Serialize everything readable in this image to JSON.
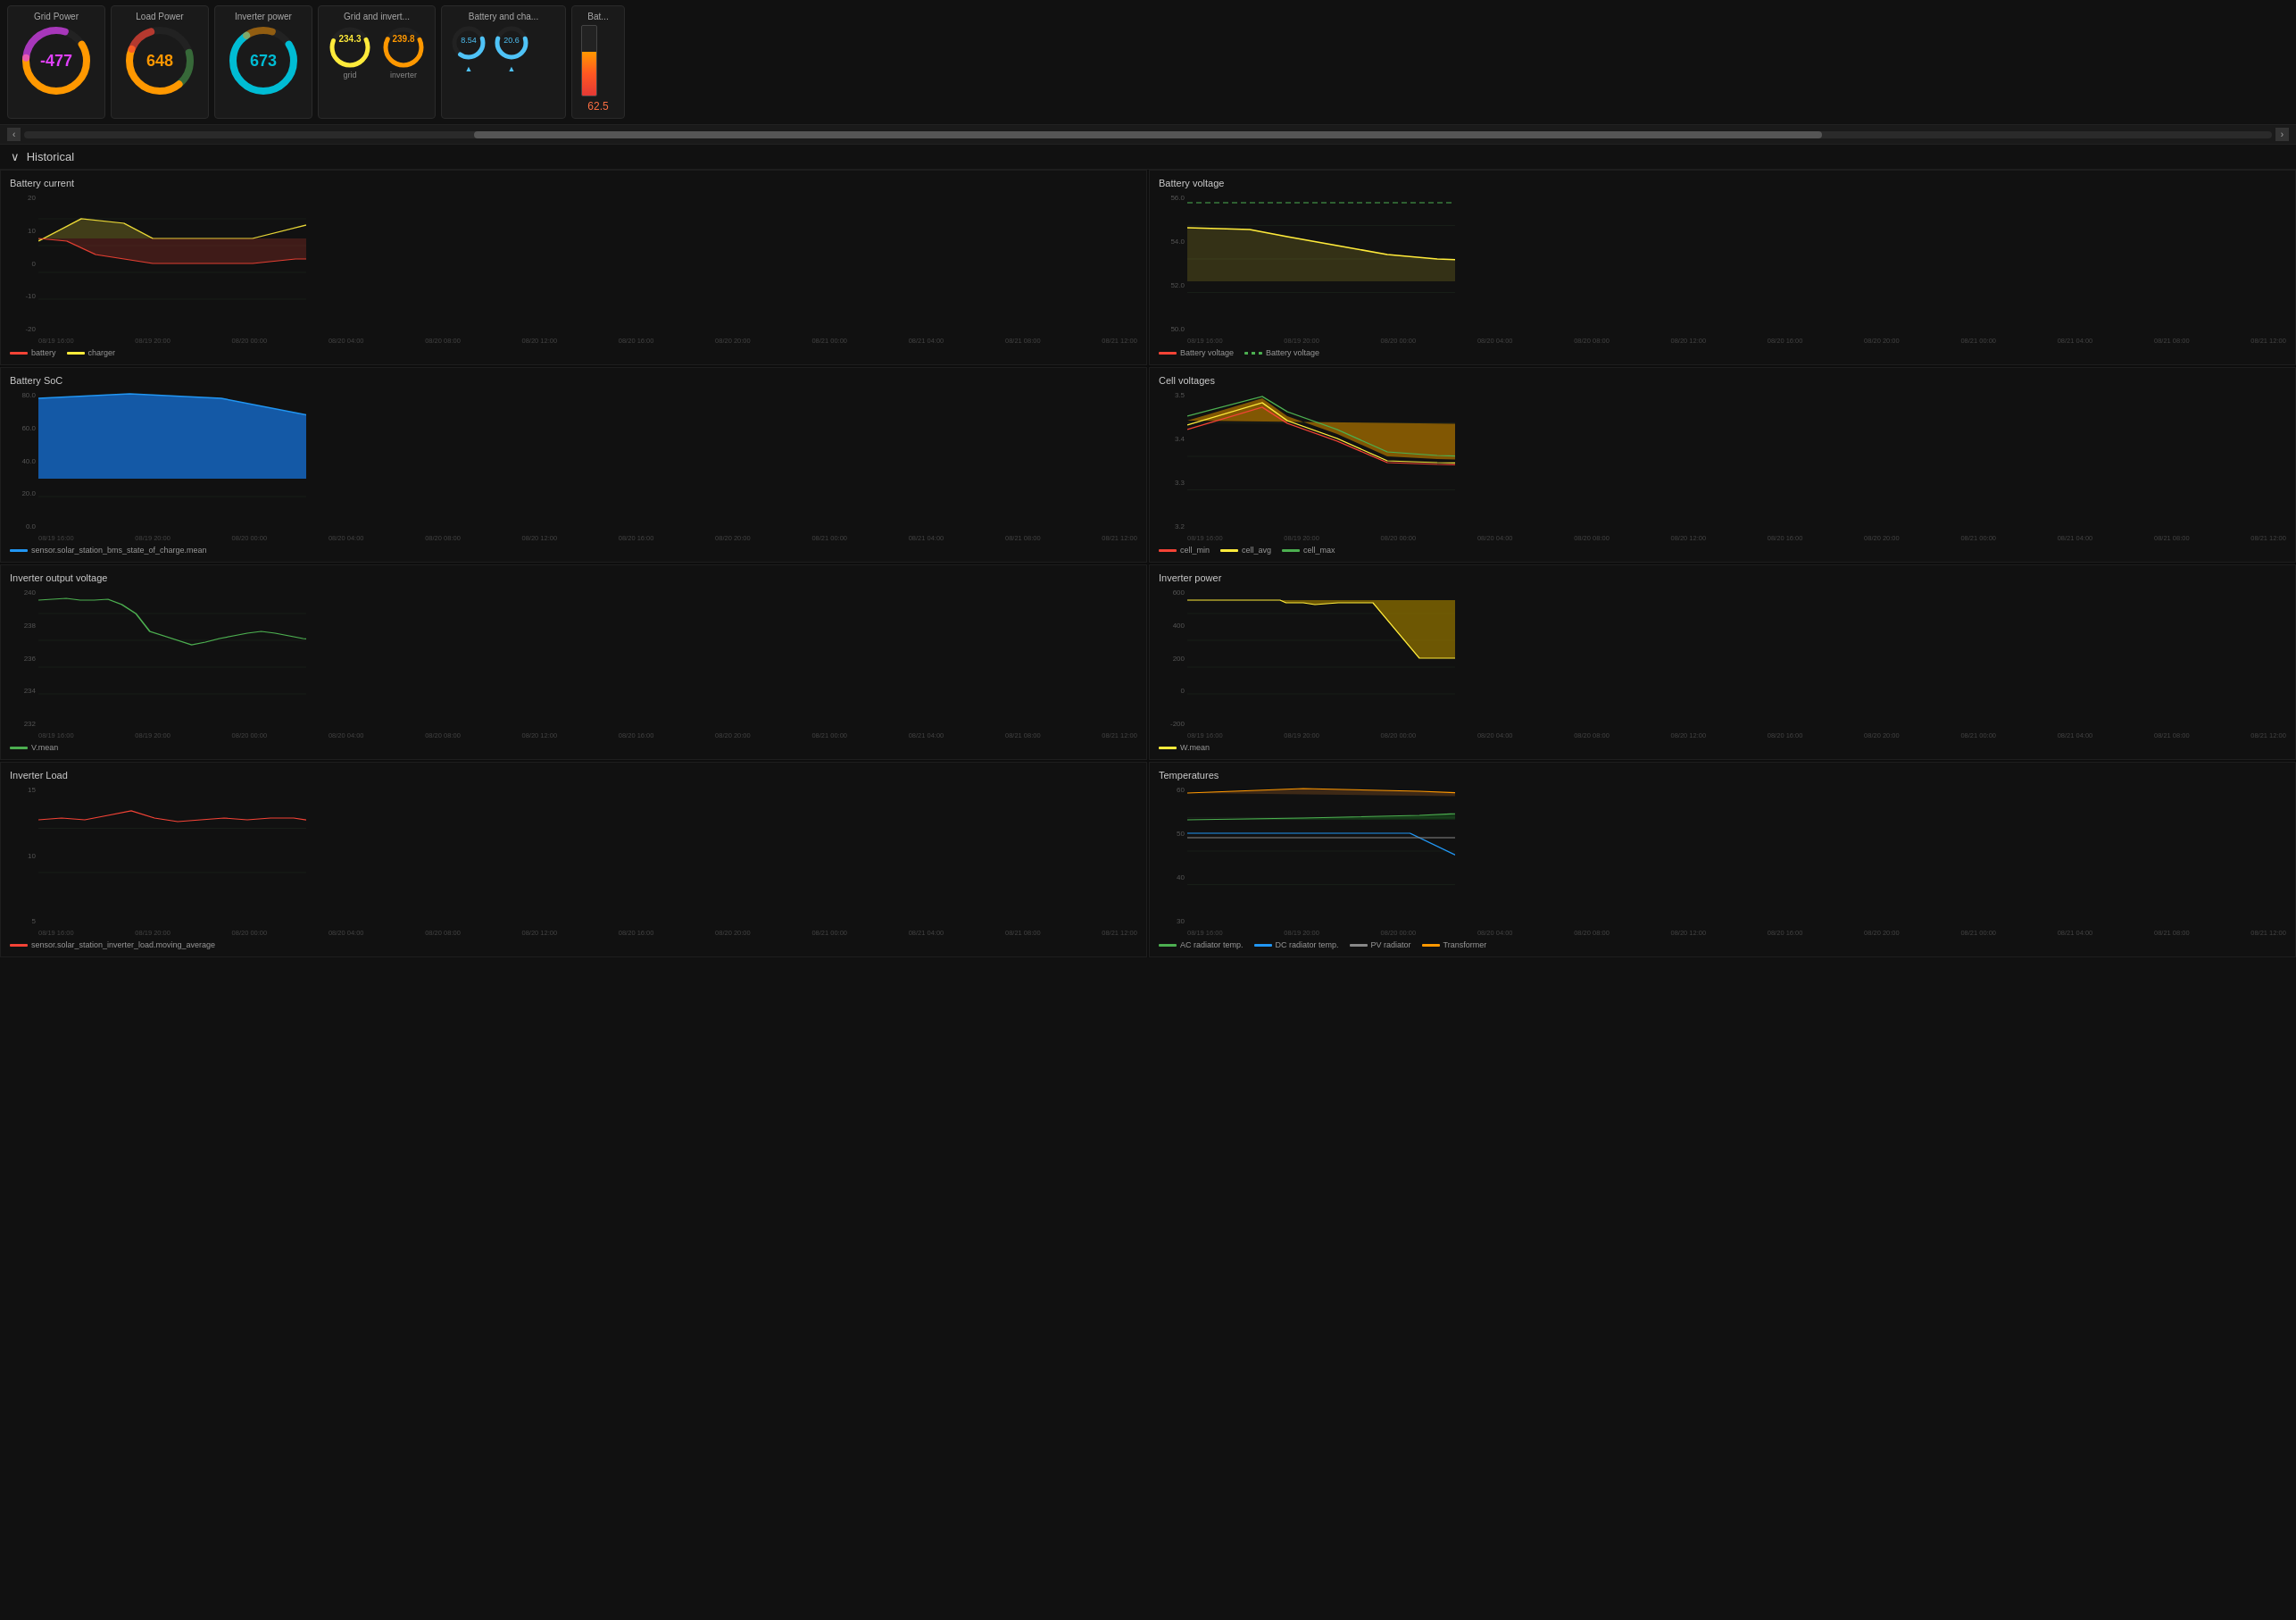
{
  "topBar": {
    "cards": [
      {
        "id": "grid-power",
        "title": "Grid Power",
        "value": "-477",
        "valueClass": "negative",
        "gaugeColor": "#e040fb",
        "arcColor": "#ff9800",
        "bgColor": "#1a1a1a"
      },
      {
        "id": "load-power",
        "title": "Load Power",
        "value": "648",
        "valueClass": "orange",
        "gaugeColor": "#ff9800",
        "arcColor": "#ff9800",
        "bgColor": "#1a1a1a"
      },
      {
        "id": "inverter-power",
        "title": "Inverter power",
        "value": "673",
        "valueClass": "cyan",
        "gaugeColor": "#00bcd4",
        "arcColor": "#00bcd4",
        "bgColor": "#1a1a1a"
      }
    ],
    "gridInverter": {
      "title": "Grid and invert...",
      "gridLabel": "grid",
      "inverterLabel": "inverter",
      "gridVal": "234.3",
      "inverterVal": "239.8"
    },
    "batteryCharge": {
      "title": "Battery and cha...",
      "val1": "8.54",
      "val2": "20.6",
      "arrow1": "▲",
      "arrow2": "▲"
    },
    "bat": {
      "title": "Bat...",
      "value": "62.5",
      "fillPercent": 62.5
    }
  },
  "historical": {
    "label": "Historical",
    "chevron": "∨"
  },
  "xLabels": [
    "08/19 16:00",
    "08/19 20:00",
    "08/20 00:00",
    "08/20 04:00",
    "08/20 08:00",
    "08/20 12:00",
    "08/20 16:00",
    "08/20 20:00",
    "08/21 00:00",
    "08/21 04:00",
    "08/21 08:00",
    "08/21 12:00"
  ],
  "charts": {
    "batteryCurrentTitle": "Battery current",
    "batteryCurrentYLabels": [
      "20",
      "10",
      "0",
      "-10",
      "-20"
    ],
    "batteryCurrentLegend": [
      {
        "label": "battery",
        "color": "#f44336"
      },
      {
        "label": "charger",
        "color": "#ffeb3b"
      }
    ],
    "batteryVoltageTitle": "Battery voltage",
    "batteryVoltageYLabels": [
      "56.0",
      "54.0",
      "52.0",
      "50.0"
    ],
    "batteryVoltageLegend": [
      {
        "label": "Battery voltage",
        "color": "#f44336",
        "dash": false
      },
      {
        "label": "Battery voltage",
        "color": "#4caf50",
        "dash": true
      }
    ],
    "batterySoCTitle": "Battery SoC",
    "batterySoCYLabels": [
      "80.0",
      "60.0",
      "40.0",
      "20.0",
      "0.0"
    ],
    "batterySoCLegend": [
      {
        "label": "sensor.solar_station_bms_state_of_charge.mean",
        "color": "#2196f3"
      }
    ],
    "cellVoltagesTitle": "Cell voltages",
    "cellVoltagesYLabels": [
      "3.5",
      "3.4",
      "3.3",
      "3.2"
    ],
    "cellVoltagesLegend": [
      {
        "label": "cell_min",
        "color": "#f44336"
      },
      {
        "label": "cell_avg",
        "color": "#ffeb3b"
      },
      {
        "label": "cell_max",
        "color": "#4caf50"
      }
    ],
    "inverterOutputTitle": "Inverter output voltage",
    "inverterOutputYLabels": [
      "240",
      "238",
      "236",
      "234",
      "232"
    ],
    "inverterOutputLegend": [
      {
        "label": "V.mean",
        "color": "#4caf50"
      }
    ],
    "inverterPowerTitle": "Inverter power",
    "inverterPowerYLabels": [
      "600",
      "400",
      "200",
      "0",
      "-200"
    ],
    "inverterPowerLegend": [
      {
        "label": "W.mean",
        "color": "#ffeb3b"
      }
    ],
    "inverterLoadTitle": "Inverter Load",
    "inverterLoadYLabels": [
      "15",
      "10",
      "5"
    ],
    "inverterLoadLegend": [
      {
        "label": "sensor.solar_station_inverter_load.moving_average",
        "color": "#f44336"
      }
    ],
    "temperaturesTitle": "Temperatures",
    "temperaturesYLabels": [
      "60",
      "50",
      "40",
      "30"
    ],
    "temperaturesLegend": [
      {
        "label": "AC radiator temp.",
        "color": "#4caf50"
      },
      {
        "label": "DC radiator temp.",
        "color": "#2196f3"
      },
      {
        "label": "PV radiator",
        "color": "#888888"
      },
      {
        "label": "Transformer",
        "color": "#ff9800"
      }
    ]
  },
  "colors": {
    "background": "#111111",
    "cardBg": "#1a1a1a",
    "border": "#2a2a2a",
    "gridLine": "#1e2a1e",
    "accent": "#ffeb3b"
  }
}
